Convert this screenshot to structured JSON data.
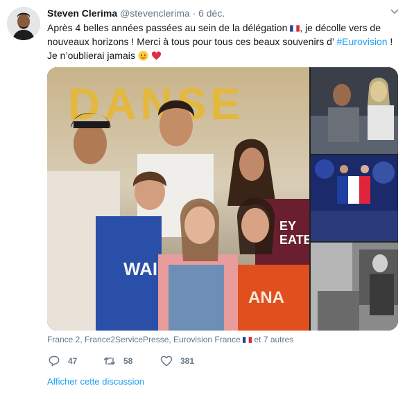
{
  "tweet": {
    "author_name": "Steven Clerima",
    "handle": "@stevenclerima",
    "separator": "·",
    "time": "6 déc.",
    "text_part1": "Après 4 belles années passées au sein de la délégation",
    "text_part2": ", je décolle vers de nouveaux horizons ! Merci à tous pour tous ces beaux souvenirs d’",
    "hashtag": "#Eurovision",
    "text_part3": " ! Je n’oublierai jamais",
    "photo_text_danse": "DANSE",
    "photo_text_hoodie": "WAI",
    "photo_text_sweater": "ANA",
    "photo_text_dark_sweater": "EY\nEATER",
    "tagged_users": "France 2, France2ServicePresse, Eurovision France",
    "tagged_suffix": "et 7 autres",
    "reply_count": "47",
    "retweet_count": "58",
    "like_count": "381",
    "show_thread": "Afficher cette discussion"
  },
  "icons": {
    "more": "chevron-down-icon",
    "flag": "french-flag-icon",
    "smile": "smiling-face-icon",
    "heart": "red-heart-icon",
    "reply": "reply-icon",
    "retweet": "retweet-icon",
    "like": "like-icon"
  },
  "colors": {
    "text": "#14171a",
    "secondary": "#657786",
    "link": "#1da1f2",
    "heart": "#e0245e"
  }
}
